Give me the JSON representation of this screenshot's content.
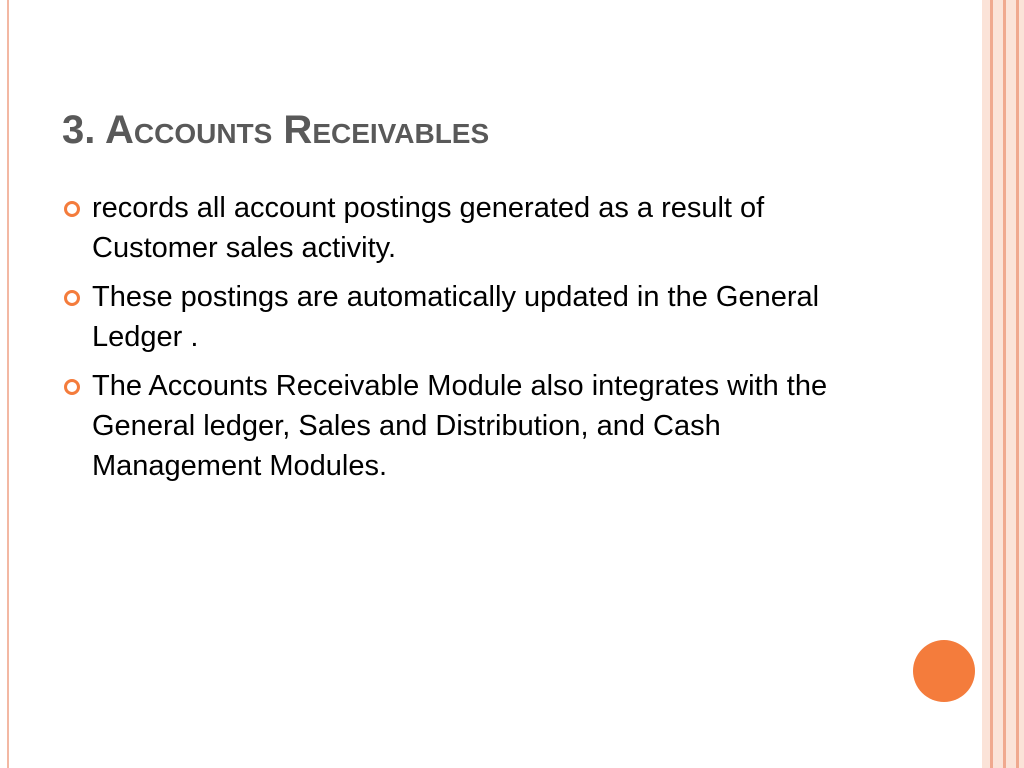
{
  "slide": {
    "title": "3. Accounts Receivables",
    "bullets": [
      "records all account postings generated as a result of Customer sales activity.",
      "These postings are automatically updated in the General Ledger .",
      "The Accounts Receivable Module also integrates with the General ledger, Sales and Distribution, and Cash Management Modules."
    ]
  },
  "colors": {
    "accent": "#f47c3c",
    "title": "#595959",
    "border": "#f0a98f"
  }
}
